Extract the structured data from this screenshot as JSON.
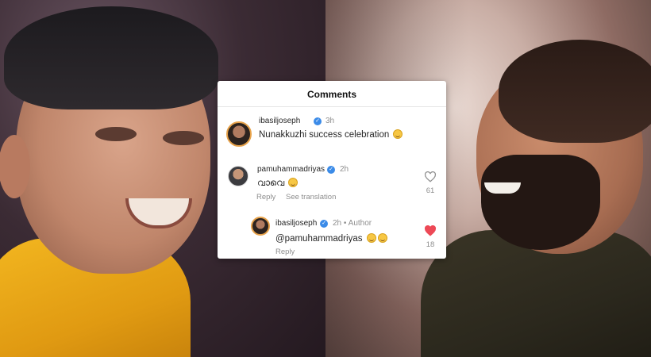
{
  "panel": {
    "title": "Comments"
  },
  "comments": [
    {
      "username": "ibasiljoseph",
      "time": "3h",
      "text": "Nunakkuzhi success celebration"
    },
    {
      "username": "pamuhammadriyas",
      "time": "2h",
      "text": "വാവെ",
      "reply_label": "Reply",
      "translate_label": "See translation",
      "likes": "61",
      "liked": false
    },
    {
      "username": "ibasiljoseph",
      "time": "2h",
      "separator": "•",
      "badge": "Author",
      "text": "@pamuhammadriyas",
      "reply_label": "Reply",
      "likes": "18",
      "liked": true
    }
  ],
  "icons": {
    "verified": "verified-badge-icon",
    "like_outline": "heart-outline-icon",
    "like_filled": "heart-filled-icon",
    "emoji": "smiling-face-emoji",
    "laugh": "tears-of-joy-emoji"
  },
  "colors": {
    "verified_blue": "#3b8be8",
    "like_red": "#ed4956",
    "muted_text": "#8e8e8e"
  }
}
